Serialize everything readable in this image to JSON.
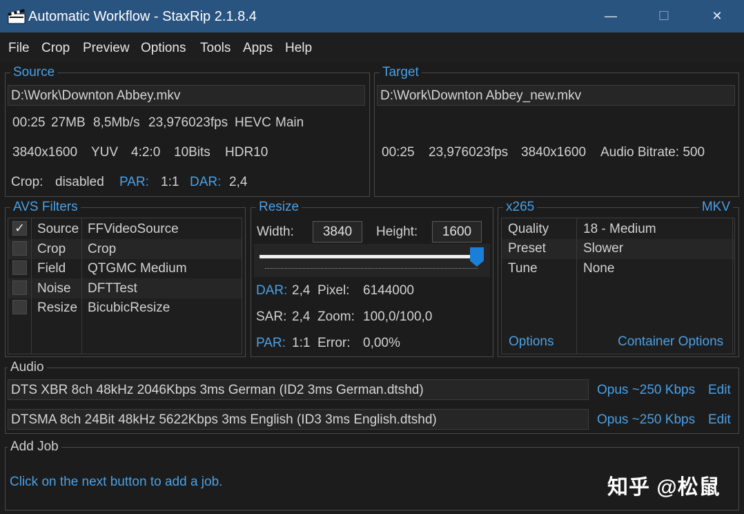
{
  "window": {
    "title": "Automatic Workflow - StaxRip 2.1.8.4",
    "icon": "clapperboard-icon",
    "minimize": "—",
    "maximize": "☐",
    "close": "✕"
  },
  "menu": [
    "File",
    "Crop",
    "Preview",
    "Options",
    "Tools",
    "Apps",
    "Help"
  ],
  "source": {
    "legend": "Source",
    "path": "D:\\Work\\Downton Abbey.mkv",
    "row1": [
      "00:25",
      "27MB",
      "8,5Mb/s",
      "23,976023fps",
      "HEVC",
      "Main"
    ],
    "row2": [
      "3840x1600",
      "YUV",
      "4:2:0",
      "10Bits",
      "HDR10"
    ],
    "crop_label": "Crop:",
    "crop_value": "disabled",
    "par_label": "PAR:",
    "par_value": "1:1",
    "dar_label": "DAR:",
    "dar_value": "2,4"
  },
  "target": {
    "legend": "Target",
    "path": "D:\\Work\\Downton Abbey_new.mkv",
    "row": [
      "00:25",
      "23,976023fps",
      "3840x1600",
      "Audio Bitrate: 500"
    ]
  },
  "avs_filters": {
    "legend": "AVS Filters",
    "rows": [
      {
        "checked": true,
        "category": "Source",
        "name": "FFVideoSource"
      },
      {
        "checked": false,
        "category": "Crop",
        "name": "Crop"
      },
      {
        "checked": false,
        "category": "Field",
        "name": "QTGMC Medium"
      },
      {
        "checked": false,
        "category": "Noise",
        "name": "DFTTest"
      },
      {
        "checked": false,
        "category": "Resize",
        "name": "BicubicResize"
      }
    ],
    "check_mark": "✓"
  },
  "resize": {
    "legend": "Resize",
    "width_label": "Width:",
    "width_value": "3840",
    "height_label": "Height:",
    "height_value": "1600",
    "slider_level": 1.0,
    "dar_label": "DAR:",
    "dar_value": "2,4",
    "pixel_label": "Pixel:",
    "pixel_value": "6144000",
    "sar_label": "SAR:",
    "sar_value": "2,4",
    "zoom_label": "Zoom:",
    "zoom_value": "100,0/100,0",
    "par_label": "PAR:",
    "par_value": "1:1",
    "error_label": "Error:",
    "error_value": "0,00%"
  },
  "encoder": {
    "legend": "x265",
    "container": "MKV",
    "rows": [
      {
        "key": "Quality",
        "value": "18 - Medium"
      },
      {
        "key": "Preset",
        "value": "Slower"
      },
      {
        "key": "Tune",
        "value": "None"
      }
    ],
    "options_link": "Options",
    "container_options_link": "Container Options"
  },
  "audio": {
    "legend": "Audio",
    "tracks": [
      {
        "path": "DTS XBR 8ch 48kHz 2046Kbps 3ms German (ID2 3ms German.dtshd)",
        "profile": "Opus ~250 Kbps",
        "edit": "Edit"
      },
      {
        "path": "DTSMA 8ch 24Bit 48kHz 5622Kbps 3ms English (ID3 3ms English.dtshd)",
        "profile": "Opus ~250 Kbps",
        "edit": "Edit"
      }
    ]
  },
  "add_job": {
    "legend": "Add Job",
    "hint": "Click on the next button to add a job."
  },
  "watermark": "知乎 @松鼠",
  "colors": {
    "titlebar": "#2a5480",
    "accent": "#4aa0e6",
    "background": "#1c1c1c"
  }
}
